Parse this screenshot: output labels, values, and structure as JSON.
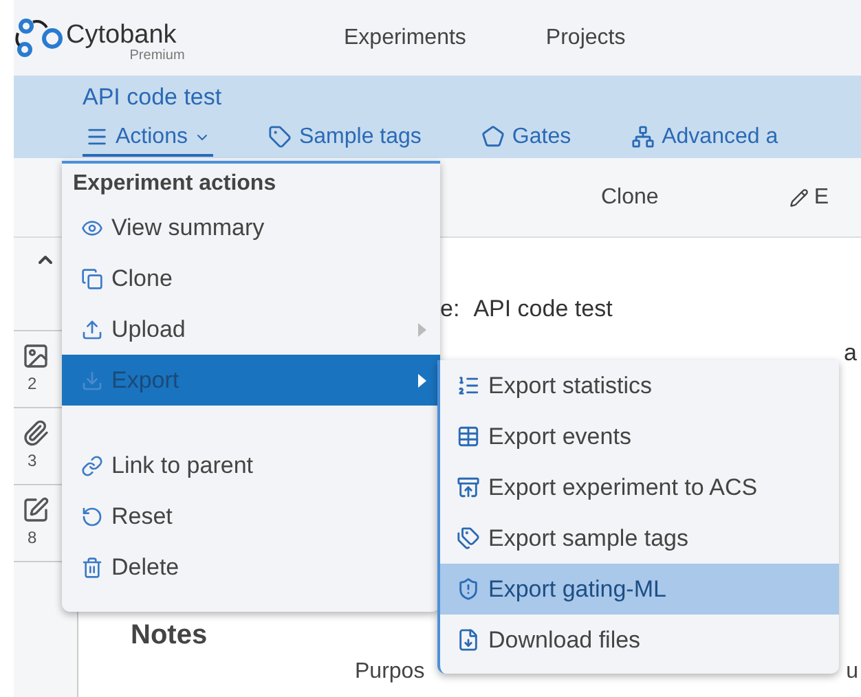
{
  "header": {
    "logo_text": "Cytobank",
    "logo_subtitle": "Premium",
    "nav": [
      {
        "label": "Experiments"
      },
      {
        "label": "Projects"
      }
    ]
  },
  "experiment": {
    "title": "API code test",
    "tabs": [
      {
        "label": "Actions",
        "selected": true,
        "dropdown": true
      },
      {
        "label": "Sample tags",
        "selected": false,
        "dropdown": false
      },
      {
        "label": "Gates",
        "selected": false,
        "dropdown": false
      },
      {
        "label": "Advanced a",
        "selected": false,
        "dropdown": false
      }
    ]
  },
  "toolbar": {
    "items": [
      {
        "label": "Clone"
      },
      {
        "label": "E"
      }
    ]
  },
  "rail": {
    "items": [
      {
        "count": "2"
      },
      {
        "count": "3"
      },
      {
        "count": "8"
      }
    ]
  },
  "content": {
    "name_label": "e:",
    "name_value": "API code test",
    "fragment": "a",
    "notes_heading": "Notes",
    "purpose_label": "Purpos",
    "purpose_fragment": "u"
  },
  "actions_menu": {
    "header": "Experiment actions",
    "items": [
      {
        "kind": "item",
        "label": "View summary",
        "selected": false,
        "submenu": false
      },
      {
        "kind": "item",
        "label": "Clone",
        "selected": false,
        "submenu": false
      },
      {
        "kind": "item",
        "label": "Upload",
        "selected": false,
        "submenu": true
      },
      {
        "kind": "item",
        "label": "Export",
        "selected": true,
        "submenu": true
      },
      {
        "kind": "gap"
      },
      {
        "kind": "item",
        "label": "Link to parent",
        "selected": false,
        "submenu": false
      },
      {
        "kind": "item",
        "label": "Reset",
        "selected": false,
        "submenu": false
      },
      {
        "kind": "item",
        "label": "Delete",
        "selected": false,
        "submenu": false
      }
    ]
  },
  "export_menu": {
    "items": [
      {
        "label": "Export statistics",
        "selected": false
      },
      {
        "label": "Export events",
        "selected": false
      },
      {
        "label": "Export experiment to ACS",
        "selected": false
      },
      {
        "label": "Export sample tags",
        "selected": false
      },
      {
        "label": "Export gating-ML",
        "selected": true
      },
      {
        "label": "Download files",
        "selected": false
      }
    ]
  }
}
